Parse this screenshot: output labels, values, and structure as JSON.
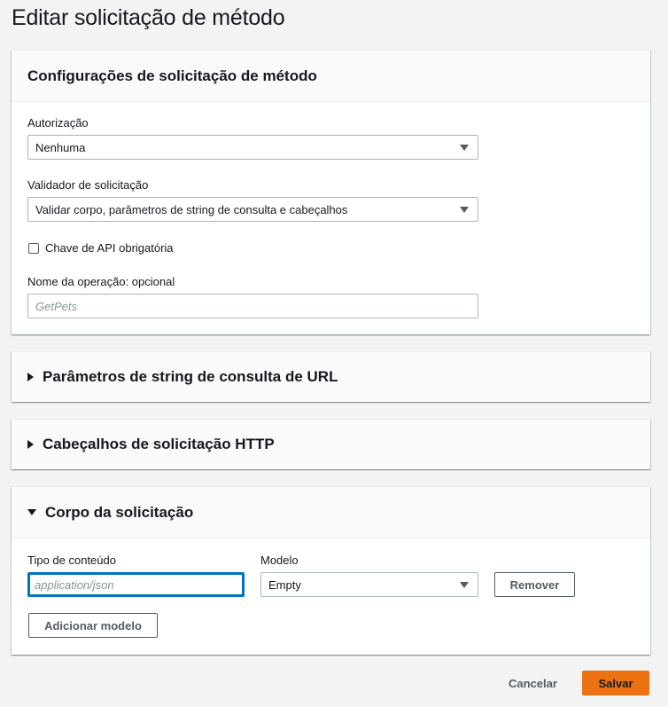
{
  "page": {
    "title": "Editar solicitação de método"
  },
  "settings_panel": {
    "title": "Configurações de solicitação de método",
    "authorization": {
      "label": "Autorização",
      "value": "Nenhuma"
    },
    "validator": {
      "label": "Validador de solicitação",
      "value": "Validar corpo, parâmetros de string de consulta e cabeçalhos"
    },
    "api_key": {
      "label": "Chave de API obrigatória",
      "checked": false
    },
    "operation_name": {
      "label": "Nome da operação: opcional",
      "placeholder": "GetPets",
      "value": ""
    }
  },
  "query_params_panel": {
    "title": "Parâmetros de string de consulta de URL",
    "expanded": false
  },
  "headers_panel": {
    "title": "Cabeçalhos de solicitação HTTP",
    "expanded": false
  },
  "body_panel": {
    "title": "Corpo da solicitação",
    "expanded": true,
    "content_type": {
      "label": "Tipo de conteúdo",
      "placeholder": "application/json"
    },
    "model": {
      "label": "Modelo",
      "value": "Empty"
    },
    "remove_label": "Remover",
    "add_model_label": "Adicionar modelo"
  },
  "footer": {
    "cancel_label": "Cancelar",
    "save_label": "Salvar"
  },
  "colors": {
    "primary": "#ec7211",
    "focus": "#0073bb",
    "background": "#f2f3f3"
  }
}
